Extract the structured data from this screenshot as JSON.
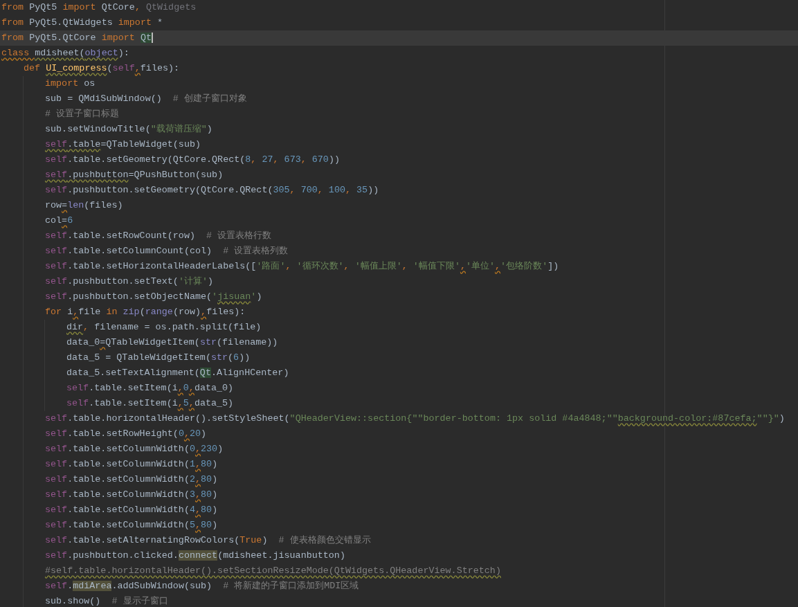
{
  "lines": [
    {
      "tokens": [
        {
          "text": "from ",
          "kind": "keyword"
        },
        {
          "text": "PyQt5 ",
          "kind": "plain"
        },
        {
          "text": "import ",
          "kind": "keyword"
        },
        {
          "text": "QtCore",
          "kind": "plain"
        },
        {
          "text": ", ",
          "kind": "keyword"
        },
        {
          "text": "QtWidgets",
          "kind": "unused"
        }
      ]
    },
    {
      "tokens": [
        {
          "text": "from ",
          "kind": "keyword"
        },
        {
          "text": "PyQt5.QtWidgets ",
          "kind": "plain"
        },
        {
          "text": "import ",
          "kind": "keyword"
        },
        {
          "text": "*",
          "kind": "plain"
        }
      ]
    },
    {
      "current": true,
      "tokens": [
        {
          "text": "from ",
          "kind": "keyword"
        },
        {
          "text": "PyQt5.QtCore ",
          "kind": "plain"
        },
        {
          "text": "import ",
          "kind": "keyword"
        },
        {
          "text": "Qt",
          "kind": "plain",
          "matched": true,
          "caret": true
        }
      ]
    },
    {
      "tokens": [
        {
          "text": "class ",
          "kind": "keyword",
          "warning": true
        },
        {
          "text": "mdisheet(",
          "kind": "plain",
          "warning": true
        },
        {
          "text": "object",
          "kind": "builtin",
          "warning": true
        },
        {
          "text": "):",
          "kind": "plain"
        }
      ],
      "children": [
        {
          "tokens": [
            {
              "text": "def ",
              "kind": "keyword"
            },
            {
              "text": "UI_compress",
              "kind": "function",
              "warning": true
            },
            {
              "text": "(",
              "kind": "plain"
            },
            {
              "text": "self",
              "kind": "self"
            },
            {
              "text": ",",
              "kind": "keyword",
              "warning": true
            },
            {
              "text": "files):",
              "kind": "plain"
            }
          ],
          "children": [
            {
              "tokens": [
                {
                  "text": "import ",
                  "kind": "keyword"
                },
                {
                  "text": "os",
                  "kind": "plain"
                }
              ]
            },
            {
              "tokens": [
                {
                  "text": "sub = QMdiSubWindow()  ",
                  "kind": "plain"
                },
                {
                  "text": "# 创建子窗口对象",
                  "kind": "comment"
                }
              ]
            },
            {
              "tokens": [
                {
                  "text": "# 设置子窗口标题",
                  "kind": "comment"
                }
              ]
            },
            {
              "tokens": [
                {
                  "text": "sub.setWindowTitle(",
                  "kind": "plain"
                },
                {
                  "text": "\"载荷谱压缩\"",
                  "kind": "string"
                },
                {
                  "text": ")",
                  "kind": "plain"
                }
              ]
            },
            {
              "tokens": [
                {
                  "text": "self",
                  "kind": "self",
                  "warning": true
                },
                {
                  "text": ".table",
                  "kind": "plain",
                  "warning": true
                },
                {
                  "text": "=QTableWidget(sub)",
                  "kind": "plain"
                }
              ]
            },
            {
              "tokens": [
                {
                  "text": "self",
                  "kind": "self"
                },
                {
                  "text": ".table.setGeometry(QtCore.QRect(",
                  "kind": "plain"
                },
                {
                  "text": "8",
                  "kind": "number"
                },
                {
                  "text": ", ",
                  "kind": "keyword"
                },
                {
                  "text": "27",
                  "kind": "number"
                },
                {
                  "text": ", ",
                  "kind": "keyword"
                },
                {
                  "text": "673",
                  "kind": "number"
                },
                {
                  "text": ", ",
                  "kind": "keyword"
                },
                {
                  "text": "670",
                  "kind": "number"
                },
                {
                  "text": "))",
                  "kind": "plain"
                }
              ]
            },
            {
              "tokens": [
                {
                  "text": "self",
                  "kind": "self",
                  "warning": true
                },
                {
                  "text": ".pushbutton",
                  "kind": "plain",
                  "warning": true
                },
                {
                  "text": "=QPushButton(sub)",
                  "kind": "plain"
                }
              ]
            },
            {
              "tokens": [
                {
                  "text": "self",
                  "kind": "self"
                },
                {
                  "text": ".pushbutton.setGeometry(QtCore.QRect(",
                  "kind": "plain"
                },
                {
                  "text": "305",
                  "kind": "number"
                },
                {
                  "text": ", ",
                  "kind": "keyword"
                },
                {
                  "text": "700",
                  "kind": "number"
                },
                {
                  "text": ", ",
                  "kind": "keyword"
                },
                {
                  "text": "100",
                  "kind": "number"
                },
                {
                  "text": ", ",
                  "kind": "keyword"
                },
                {
                  "text": "35",
                  "kind": "number"
                },
                {
                  "text": "))",
                  "kind": "plain"
                }
              ]
            },
            {
              "tokens": [
                {
                  "text": "row",
                  "kind": "plain"
                },
                {
                  "text": "=",
                  "kind": "plain",
                  "warning": true
                },
                {
                  "text": "len",
                  "kind": "builtin"
                },
                {
                  "text": "(files)",
                  "kind": "plain"
                }
              ]
            },
            {
              "tokens": [
                {
                  "text": "col",
                  "kind": "plain"
                },
                {
                  "text": "=",
                  "kind": "plain",
                  "warning": true
                },
                {
                  "text": "6",
                  "kind": "number"
                }
              ]
            },
            {
              "tokens": [
                {
                  "text": "self",
                  "kind": "self"
                },
                {
                  "text": ".table.setRowCount(row)  ",
                  "kind": "plain"
                },
                {
                  "text": "# 设置表格行数",
                  "kind": "comment"
                }
              ]
            },
            {
              "tokens": [
                {
                  "text": "self",
                  "kind": "self"
                },
                {
                  "text": ".table.setColumnCount(col)  ",
                  "kind": "plain"
                },
                {
                  "text": "# 设置表格列数",
                  "kind": "comment"
                }
              ]
            },
            {
              "tokens": [
                {
                  "text": "self",
                  "kind": "self"
                },
                {
                  "text": ".table.setHorizontalHeaderLabels([",
                  "kind": "plain"
                },
                {
                  "text": "'路面'",
                  "kind": "string"
                },
                {
                  "text": ", ",
                  "kind": "keyword"
                },
                {
                  "text": "'循环次数'",
                  "kind": "string"
                },
                {
                  "text": ", ",
                  "kind": "keyword"
                },
                {
                  "text": "'幅值上限'",
                  "kind": "string"
                },
                {
                  "text": ", ",
                  "kind": "keyword"
                },
                {
                  "text": "'幅值下限'",
                  "kind": "string"
                },
                {
                  "text": ",",
                  "kind": "keyword",
                  "warning": true
                },
                {
                  "text": "'单位'",
                  "kind": "string"
                },
                {
                  "text": ",",
                  "kind": "keyword",
                  "warning": true
                },
                {
                  "text": "'包络阶数'",
                  "kind": "string"
                },
                {
                  "text": "])",
                  "kind": "plain"
                }
              ]
            },
            {
              "tokens": [
                {
                  "text": "self",
                  "kind": "self"
                },
                {
                  "text": ".pushbutton.setText(",
                  "kind": "plain"
                },
                {
                  "text": "'计算'",
                  "kind": "string"
                },
                {
                  "text": ")",
                  "kind": "plain"
                }
              ]
            },
            {
              "tokens": [
                {
                  "text": "self",
                  "kind": "self"
                },
                {
                  "text": ".pushbutton.setObjectName(",
                  "kind": "plain"
                },
                {
                  "text": "'",
                  "kind": "string"
                },
                {
                  "text": "jisuan",
                  "kind": "string",
                  "warning": true
                },
                {
                  "text": "'",
                  "kind": "string"
                },
                {
                  "text": ")",
                  "kind": "plain"
                }
              ]
            },
            {
              "tokens": [
                {
                  "text": "for ",
                  "kind": "keyword"
                },
                {
                  "text": "i",
                  "kind": "plain"
                },
                {
                  "text": ",",
                  "kind": "keyword",
                  "warning": true
                },
                {
                  "text": "file ",
                  "kind": "plain"
                },
                {
                  "text": "in ",
                  "kind": "keyword"
                },
                {
                  "text": "zip",
                  "kind": "builtin"
                },
                {
                  "text": "(",
                  "kind": "plain"
                },
                {
                  "text": "range",
                  "kind": "builtin"
                },
                {
                  "text": "(row)",
                  "kind": "plain"
                },
                {
                  "text": ",",
                  "kind": "keyword",
                  "warning": true
                },
                {
                  "text": "files):",
                  "kind": "plain"
                }
              ],
              "children": [
                {
                  "tokens": [
                    {
                      "text": "dir",
                      "kind": "plain",
                      "warning": true
                    },
                    {
                      "text": ", ",
                      "kind": "keyword"
                    },
                    {
                      "text": "filename = os.path.split(file)",
                      "kind": "plain"
                    }
                  ]
                },
                {
                  "tokens": [
                    {
                      "text": "data_0",
                      "kind": "plain"
                    },
                    {
                      "text": "=",
                      "kind": "plain",
                      "warning": true
                    },
                    {
                      "text": "QTableWidgetItem(",
                      "kind": "plain"
                    },
                    {
                      "text": "str",
                      "kind": "builtin"
                    },
                    {
                      "text": "(filename))",
                      "kind": "plain"
                    }
                  ]
                },
                {
                  "tokens": [
                    {
                      "text": "data_5 = QTableWidgetItem(",
                      "kind": "plain"
                    },
                    {
                      "text": "str",
                      "kind": "builtin"
                    },
                    {
                      "text": "(",
                      "kind": "plain"
                    },
                    {
                      "text": "6",
                      "kind": "number"
                    },
                    {
                      "text": "))",
                      "kind": "plain"
                    }
                  ]
                },
                {
                  "tokens": [
                    {
                      "text": "data_5.setTextAlignment(",
                      "kind": "plain"
                    },
                    {
                      "text": "Qt",
                      "kind": "plain",
                      "matched": true
                    },
                    {
                      "text": ".AlignHCenter)",
                      "kind": "plain"
                    }
                  ]
                },
                {
                  "tokens": [
                    {
                      "text": "self",
                      "kind": "self"
                    },
                    {
                      "text": ".table.setItem(i",
                      "kind": "plain"
                    },
                    {
                      "text": ",",
                      "kind": "keyword",
                      "warning": true
                    },
                    {
                      "text": "0",
                      "kind": "number"
                    },
                    {
                      "text": ",",
                      "kind": "keyword",
                      "warning": true
                    },
                    {
                      "text": "data_0)",
                      "kind": "plain"
                    }
                  ]
                },
                {
                  "tokens": [
                    {
                      "text": "self",
                      "kind": "self"
                    },
                    {
                      "text": ".table.setItem(i",
                      "kind": "plain"
                    },
                    {
                      "text": ",",
                      "kind": "keyword",
                      "warning": true
                    },
                    {
                      "text": "5",
                      "kind": "number"
                    },
                    {
                      "text": ",",
                      "kind": "keyword",
                      "warning": true
                    },
                    {
                      "text": "data_5)",
                      "kind": "plain"
                    }
                  ]
                }
              ]
            },
            {
              "tokens": [
                {
                  "text": "self",
                  "kind": "self"
                },
                {
                  "text": ".table.horizontalHeader().setStyleSheet(",
                  "kind": "plain"
                },
                {
                  "text": "\"QHeaderView::section{\"\"border-bottom: 1px solid #4a4848;\"\"",
                  "kind": "string"
                },
                {
                  "text": "background-color:#87cefa;",
                  "kind": "string",
                  "warning": true
                },
                {
                  "text": "\"\"}\"",
                  "kind": "string"
                },
                {
                  "text": ")",
                  "kind": "plain"
                }
              ]
            },
            {
              "tokens": [
                {
                  "text": "self",
                  "kind": "self"
                },
                {
                  "text": ".table.setRowHeight(",
                  "kind": "plain"
                },
                {
                  "text": "0",
                  "kind": "number"
                },
                {
                  "text": ",",
                  "kind": "keyword",
                  "warning": true
                },
                {
                  "text": "20",
                  "kind": "number"
                },
                {
                  "text": ")",
                  "kind": "plain"
                }
              ]
            },
            {
              "tokens": [
                {
                  "text": "self",
                  "kind": "self"
                },
                {
                  "text": ".table.setColumnWidth(",
                  "kind": "plain"
                },
                {
                  "text": "0",
                  "kind": "number"
                },
                {
                  "text": ",",
                  "kind": "keyword",
                  "warning": true
                },
                {
                  "text": "230",
                  "kind": "number"
                },
                {
                  "text": ")",
                  "kind": "plain"
                }
              ]
            },
            {
              "tokens": [
                {
                  "text": "self",
                  "kind": "self"
                },
                {
                  "text": ".table.setColumnWidth(",
                  "kind": "plain"
                },
                {
                  "text": "1",
                  "kind": "number"
                },
                {
                  "text": ",",
                  "kind": "keyword",
                  "warning": true
                },
                {
                  "text": "80",
                  "kind": "number"
                },
                {
                  "text": ")",
                  "kind": "plain"
                }
              ]
            },
            {
              "tokens": [
                {
                  "text": "self",
                  "kind": "self"
                },
                {
                  "text": ".table.setColumnWidth(",
                  "kind": "plain"
                },
                {
                  "text": "2",
                  "kind": "number"
                },
                {
                  "text": ",",
                  "kind": "keyword",
                  "warning": true
                },
                {
                  "text": "80",
                  "kind": "number"
                },
                {
                  "text": ")",
                  "kind": "plain"
                }
              ]
            },
            {
              "tokens": [
                {
                  "text": "self",
                  "kind": "self"
                },
                {
                  "text": ".table.setColumnWidth(",
                  "kind": "plain"
                },
                {
                  "text": "3",
                  "kind": "number"
                },
                {
                  "text": ",",
                  "kind": "keyword",
                  "warning": true
                },
                {
                  "text": "80",
                  "kind": "number"
                },
                {
                  "text": ")",
                  "kind": "plain"
                }
              ]
            },
            {
              "tokens": [
                {
                  "text": "self",
                  "kind": "self"
                },
                {
                  "text": ".table.setColumnWidth(",
                  "kind": "plain"
                },
                {
                  "text": "4",
                  "kind": "number"
                },
                {
                  "text": ",",
                  "kind": "keyword",
                  "warning": true
                },
                {
                  "text": "80",
                  "kind": "number"
                },
                {
                  "text": ")",
                  "kind": "plain"
                }
              ]
            },
            {
              "tokens": [
                {
                  "text": "self",
                  "kind": "self"
                },
                {
                  "text": ".table.setColumnWidth(",
                  "kind": "plain"
                },
                {
                  "text": "5",
                  "kind": "number"
                },
                {
                  "text": ",",
                  "kind": "keyword",
                  "warning": true
                },
                {
                  "text": "80",
                  "kind": "number"
                },
                {
                  "text": ")",
                  "kind": "plain"
                }
              ]
            },
            {
              "tokens": [
                {
                  "text": "self",
                  "kind": "self"
                },
                {
                  "text": ".table.setAlternatingRowColors(",
                  "kind": "plain"
                },
                {
                  "text": "True",
                  "kind": "keyword"
                },
                {
                  "text": ")  ",
                  "kind": "plain"
                },
                {
                  "text": "# 使表格颜色交错显示",
                  "kind": "comment"
                }
              ]
            },
            {
              "tokens": [
                {
                  "text": "self",
                  "kind": "self"
                },
                {
                  "text": ".pushbutton.clicked.",
                  "kind": "plain"
                },
                {
                  "text": "connect",
                  "kind": "plain",
                  "highlighted": true
                },
                {
                  "text": "(mdisheet.jisuanbutton)",
                  "kind": "plain"
                }
              ]
            },
            {
              "tokens": [
                {
                  "text": "#self.table.horizontalHeader().setSectionResizeMode(QtWidgets.QHeaderView.Stretch)",
                  "kind": "comment",
                  "warning": true
                }
              ]
            },
            {
              "tokens": [
                {
                  "text": "self",
                  "kind": "self"
                },
                {
                  "text": ".",
                  "kind": "plain"
                },
                {
                  "text": "mdiArea",
                  "kind": "plain",
                  "highlighted": true
                },
                {
                  "text": ".addSubWindow(sub)  ",
                  "kind": "plain"
                },
                {
                  "text": "# 将新建的子窗口添加到MDI区域",
                  "kind": "comment"
                }
              ]
            },
            {
              "tokens": [
                {
                  "text": "sub.show()  ",
                  "kind": "plain"
                },
                {
                  "text": "# 显示子窗口",
                  "kind": "comment"
                }
              ]
            }
          ]
        }
      ]
    }
  ]
}
